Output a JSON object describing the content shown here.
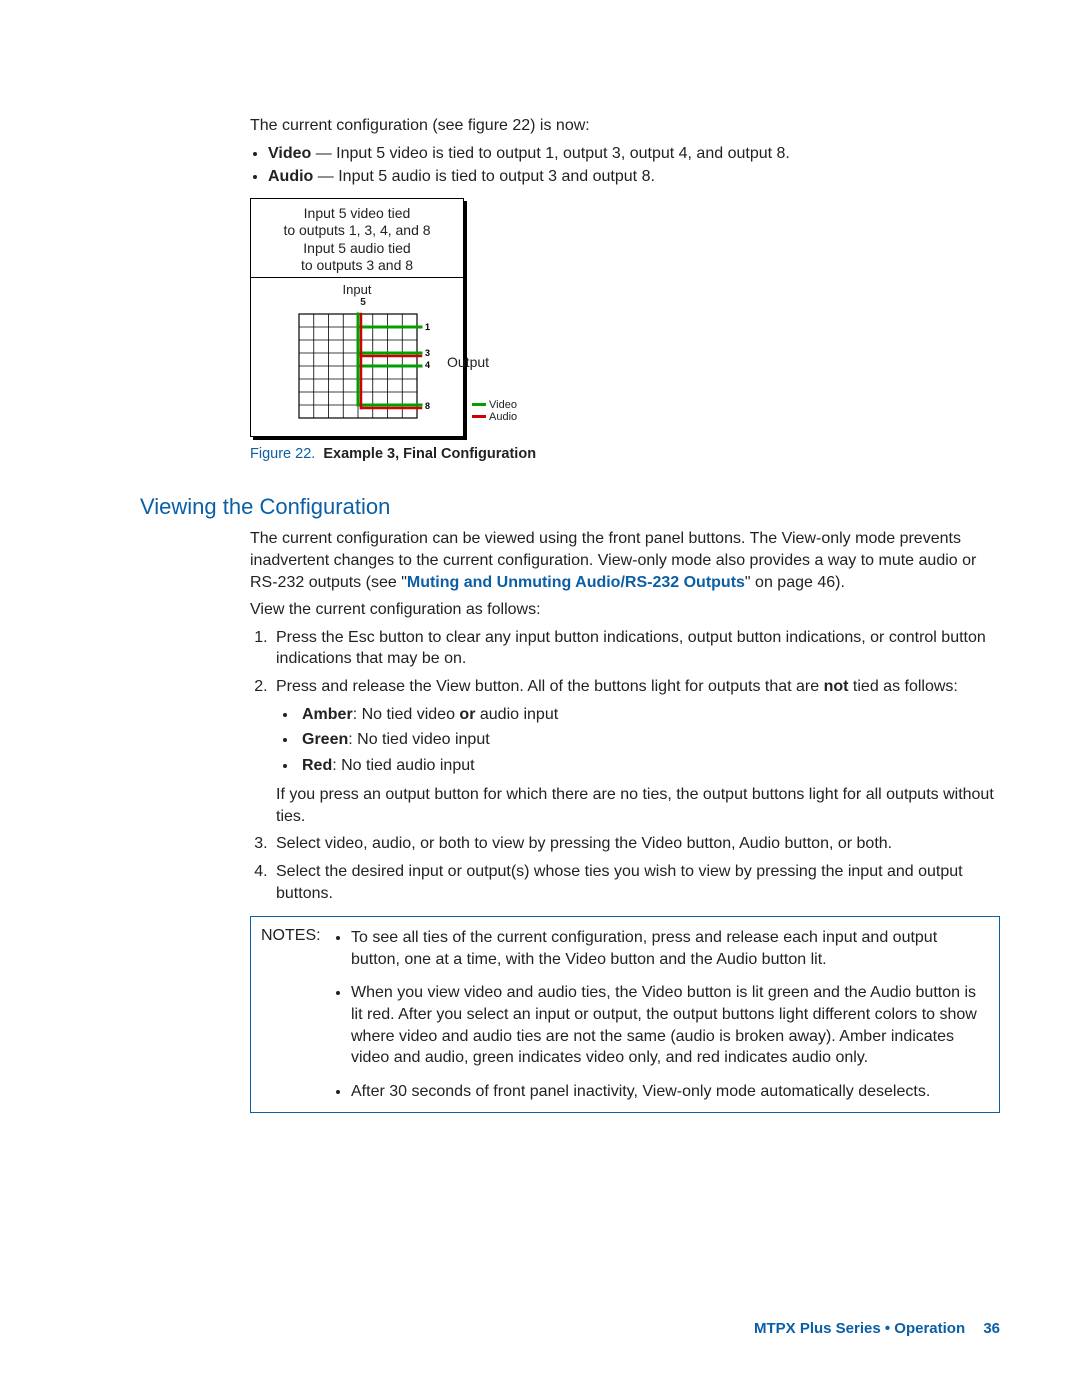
{
  "intro": "The current configuration (see figure 22) is now:",
  "bullets": {
    "video_label": "Video",
    "video_text": " — Input 5 video is tied to output 1, output 3, output 4, and output 8.",
    "audio_label": "Audio",
    "audio_text": " — Input 5 audio is tied to output 3 and output 8."
  },
  "diagram": {
    "line1": "Input 5 video tied",
    "line2": "to outputs 1, 3, 4, and 8",
    "line3": "Input 5 audio tied",
    "line4": "to outputs 3 and 8",
    "input_label": "Input",
    "input_num": "5",
    "output_label": "Output",
    "out_labels": {
      "o1": "1",
      "o3": "3",
      "o4": "4",
      "o8": "8"
    },
    "legend_video": "Video",
    "legend_audio": "Audio"
  },
  "figcaption": {
    "label": "Figure 22.",
    "bold": "Example 3, Final Configuration"
  },
  "section_heading": "Viewing the Configuration",
  "para1_a": "The current configuration can be viewed using the front panel buttons. The View-only mode prevents inadvertent changes to the current configuration. View-only mode also provides a way to mute audio or RS-232 outputs (see \"",
  "link_text": "Muting and Unmuting Audio/RS-232 Outputs",
  "para1_b": "\" on page 46).",
  "para2": "View the current configuration as follows:",
  "steps": {
    "s1": "Press the Esc button to clear any input button indications, output button indications, or control button indications that may be on.",
    "s2_a": "Press and release the View button. All of the buttons light for outputs that are ",
    "s2_not": "not",
    "s2_b": " tied as follows:",
    "s2_bullets": {
      "amber_label": "Amber",
      "amber_text_a": ": No tied video ",
      "amber_or": "or",
      "amber_text_b": " audio input",
      "green_label": "Green",
      "green_text": ": No tied video input",
      "red_label": "Red",
      "red_text": ": No tied audio input"
    },
    "s2_para": "If you press an output button for which there are no ties, the output buttons light for all outputs without ties.",
    "s3": "Select video, audio, or both to view by pressing the Video button, Audio button, or both.",
    "s4": "Select the desired input or output(s) whose ties you wish to view by pressing the input and output buttons."
  },
  "notes": {
    "label": "NOTES:",
    "n1": "To see all ties of the current configuration, press and release each input and output button, one at a time, with the Video button and the Audio button lit.",
    "n2": "When you view video and audio ties, the Video button is lit green and the Audio button is lit red. After you select an input or output, the output buttons light different colors to show where video and audio ties are not the same (audio is broken away). Amber indicates video and audio, green indicates video only, and red indicates audio only.",
    "n3": "After 30 seconds of front panel inactivity, View-only mode automatically deselects."
  },
  "footer": {
    "title": "MTPX Plus Series • Operation",
    "page": "36"
  }
}
